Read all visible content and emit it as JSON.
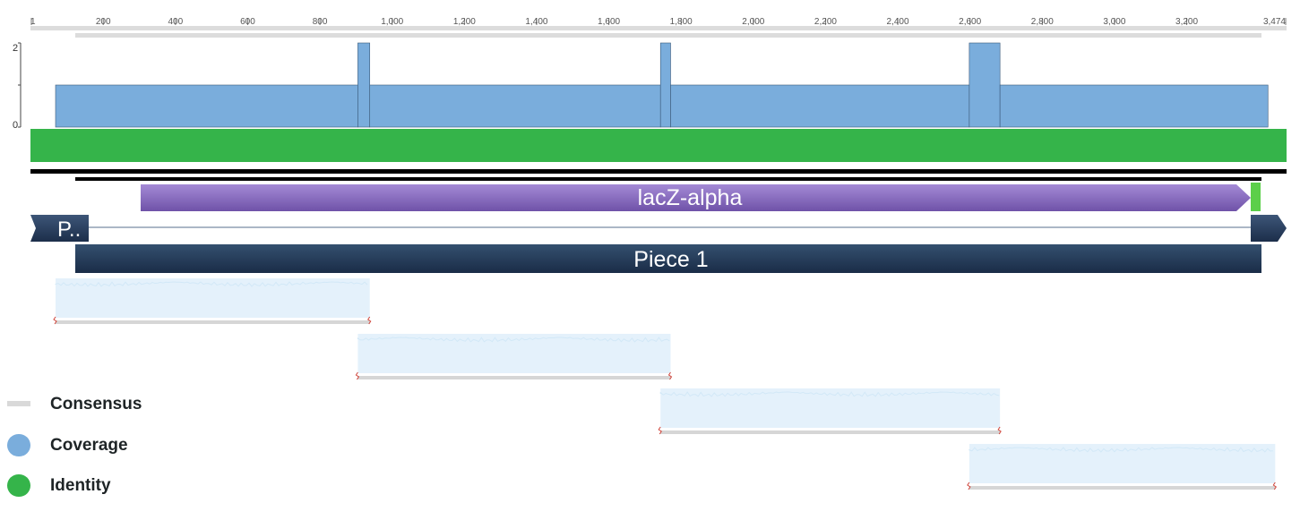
{
  "ruler": {
    "min": 1,
    "max": 3474,
    "ticks": [
      {
        "value": 1,
        "label": "1"
      },
      {
        "value": 200,
        "label": "200"
      },
      {
        "value": 400,
        "label": "400"
      },
      {
        "value": 600,
        "label": "600"
      },
      {
        "value": 800,
        "label": "800"
      },
      {
        "value": 1000,
        "label": "1,000"
      },
      {
        "value": 1200,
        "label": "1,200"
      },
      {
        "value": 1400,
        "label": "1,400"
      },
      {
        "value": 1600,
        "label": "1,600"
      },
      {
        "value": 1800,
        "label": "1,800"
      },
      {
        "value": 2000,
        "label": "2,000"
      },
      {
        "value": 2200,
        "label": "2,200"
      },
      {
        "value": 2400,
        "label": "2,400"
      },
      {
        "value": 2600,
        "label": "2,600"
      },
      {
        "value": 2800,
        "label": "2,800"
      },
      {
        "value": 3000,
        "label": "3,000"
      },
      {
        "value": 3200,
        "label": "3,200"
      },
      {
        "value": 3474,
        "label": "3,474"
      }
    ]
  },
  "coverage": {
    "y_labels": [
      "2",
      "0"
    ],
    "segments": [
      {
        "start": 68,
        "end": 905,
        "depth": 1
      },
      {
        "start": 905,
        "end": 938,
        "depth": 2
      },
      {
        "start": 938,
        "end": 1743,
        "depth": 1
      },
      {
        "start": 1743,
        "end": 1771,
        "depth": 2
      },
      {
        "start": 1771,
        "end": 2598,
        "depth": 1
      },
      {
        "start": 2598,
        "end": 2683,
        "depth": 2
      },
      {
        "start": 2683,
        "end": 3425,
        "depth": 1
      }
    ]
  },
  "annotations": {
    "lacz": {
      "label": "lacZ-alpha",
      "start": 306,
      "end": 3390
    },
    "promoter": {
      "label": "P..",
      "start": 1,
      "end": 164
    },
    "piece": {
      "label": "Piece 1",
      "start": 125,
      "end": 3454
    }
  },
  "reads": [
    {
      "start": 68,
      "end": 938
    },
    {
      "start": 905,
      "end": 1771
    },
    {
      "start": 1743,
      "end": 2683
    },
    {
      "start": 2598,
      "end": 3445
    }
  ],
  "legend": [
    {
      "label": "Consensus",
      "color": "#d9d9d9",
      "shape": "line"
    },
    {
      "label": "Coverage",
      "color": "#7aaddc",
      "shape": "dot"
    },
    {
      "label": "Identity",
      "color": "#35b44a",
      "shape": "dot"
    }
  ],
  "colors": {
    "coverage": "#7aaddc",
    "identity": "#35b44a",
    "lacz": "#7a5fb0",
    "piece": "#22385a",
    "read_fill": "#e4f1fb",
    "read_line": "#d6d6d6",
    "cut_mark": "#d0443a"
  }
}
